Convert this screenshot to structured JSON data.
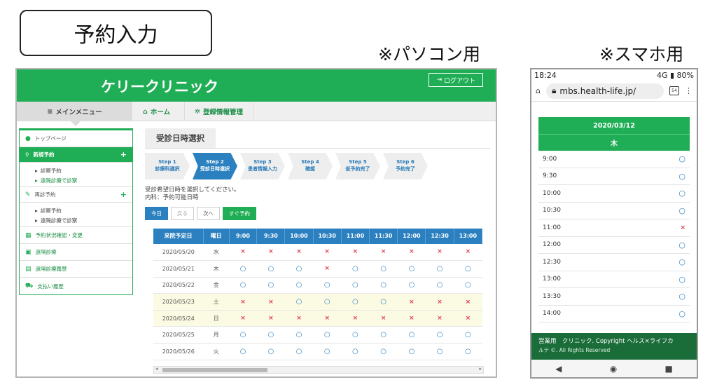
{
  "heading": "予約入力",
  "captions": {
    "pc": "※パソコン用",
    "sp": "※スマホ用"
  },
  "pc": {
    "brand": "ケリークリニック",
    "logout": "ログアウト",
    "nav": {
      "main_menu": "メインメニュー",
      "home": "ホーム",
      "register": "登録情報管理"
    },
    "sidebar": {
      "top": "トップページ",
      "new_reserve": "新規予約",
      "new_sub": [
        "診察予約",
        "遠隔診療で診察"
      ],
      "re_reserve": "再診予約",
      "re_sub": [
        "診察予約",
        "遠隔診療で診察"
      ],
      "status": "予約状況確認・変更",
      "remote": "遠隔診療",
      "remote_history": "遠隔診療履歴",
      "payment": "支払い履歴"
    },
    "section_title": "受診日時選択",
    "steps": [
      {
        "n": "Step 1",
        "l": "診療科選択"
      },
      {
        "n": "Step 2",
        "l": "受診日時選択"
      },
      {
        "n": "Step 3",
        "l": "患者情報入力"
      },
      {
        "n": "Step 4",
        "l": "確認"
      },
      {
        "n": "Step 5",
        "l": "仮予約完了"
      },
      {
        "n": "Step 6",
        "l": "予約完了"
      }
    ],
    "message1": "受診希望日時を選択してください。",
    "message2": "内科：予約可能日時",
    "buttons": {
      "today": "今日",
      "prev": "戻る",
      "next": "次へ",
      "now": "すぐ予約"
    },
    "table": {
      "headers": [
        "来院予定日",
        "曜日",
        "9:00",
        "9:30",
        "10:00",
        "10:30",
        "11:00",
        "11:30",
        "12:00",
        "12:30",
        "13:00"
      ],
      "rows": [
        {
          "date": "2020/05/20",
          "day": "水",
          "hl": false,
          "slots": [
            "×",
            "×",
            "×",
            "×",
            "×",
            "×",
            "×",
            "×",
            "×"
          ]
        },
        {
          "date": "2020/05/21",
          "day": "木",
          "hl": false,
          "slots": [
            "○",
            "○",
            "○",
            "×",
            "○",
            "○",
            "○",
            "○",
            "○"
          ]
        },
        {
          "date": "2020/05/22",
          "day": "金",
          "hl": false,
          "slots": [
            "○",
            "○",
            "○",
            "○",
            "○",
            "○",
            "○",
            "○",
            "○"
          ]
        },
        {
          "date": "2020/05/23",
          "day": "土",
          "hl": true,
          "slots": [
            "×",
            "×",
            "○",
            "○",
            "○",
            "○",
            "×",
            "×",
            "×"
          ]
        },
        {
          "date": "2020/05/24",
          "day": "日",
          "hl": true,
          "slots": [
            "×",
            "×",
            "×",
            "×",
            "×",
            "×",
            "×",
            "×",
            "×"
          ]
        },
        {
          "date": "2020/05/25",
          "day": "月",
          "hl": false,
          "slots": [
            "○",
            "○",
            "○",
            "○",
            "○",
            "○",
            "○",
            "○",
            "○"
          ]
        },
        {
          "date": "2020/05/26",
          "day": "火",
          "hl": false,
          "slots": [
            "○",
            "○",
            "○",
            "○",
            "○",
            "○",
            "○",
            "○",
            "○"
          ]
        }
      ]
    }
  },
  "sp": {
    "status_time": "18:24",
    "status_right": "4G ▮ 80%",
    "url": "mbs.health-life.jp/",
    "tab_count": "54",
    "date": "2020/03/12",
    "dow": "木",
    "slots": [
      {
        "t": "9:00",
        "s": "○"
      },
      {
        "t": "9:30",
        "s": "○"
      },
      {
        "t": "10:00",
        "s": "○"
      },
      {
        "t": "10:30",
        "s": "○"
      },
      {
        "t": "11:00",
        "s": "×"
      },
      {
        "t": "12:00",
        "s": "○"
      },
      {
        "t": "12:30",
        "s": "○"
      },
      {
        "t": "13:00",
        "s": "○"
      },
      {
        "t": "13:30",
        "s": "○"
      },
      {
        "t": "14:00",
        "s": "○"
      }
    ],
    "footer1": "営業用　クリニック. Copyright ヘルス×ライフカ",
    "footer2": "ルテ ©. All Rights Reserved"
  }
}
